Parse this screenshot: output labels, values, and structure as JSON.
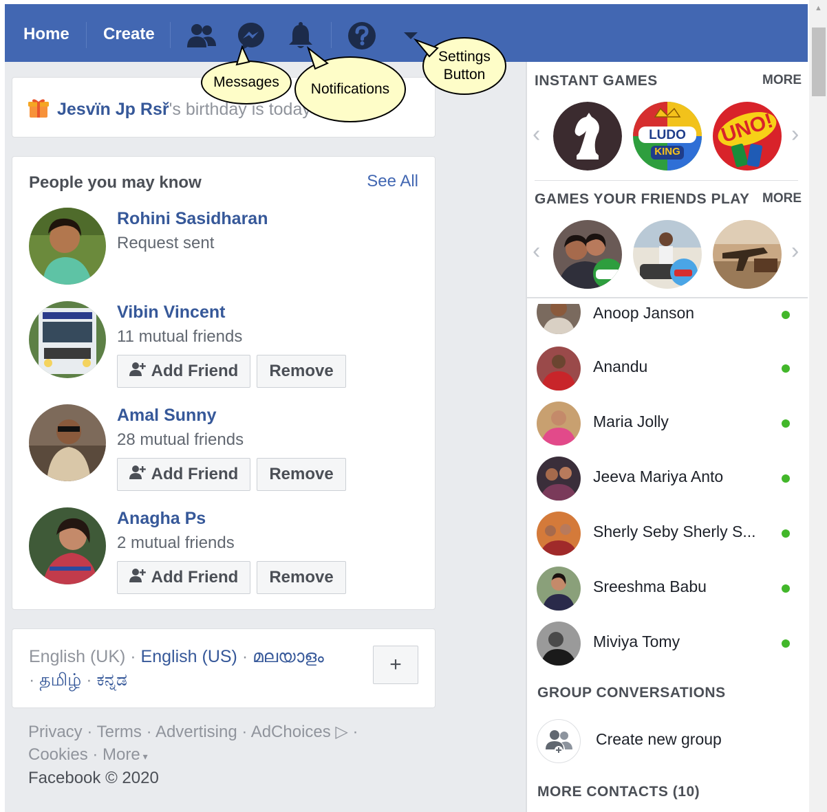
{
  "nav": {
    "home": "Home",
    "create": "Create"
  },
  "callouts": {
    "messages": "Messages",
    "notifications": "Notifications",
    "settings": "Settings\nButton"
  },
  "birthday": {
    "name": "Jesvïn Jp Rsř",
    "suffix": "'s birthday is today"
  },
  "pymk": {
    "title": "People you may know",
    "see_all": "See All",
    "add_friend": "Add Friend",
    "remove": "Remove",
    "people": [
      {
        "name": "Rohini Sasidharan",
        "sub": "Request sent"
      },
      {
        "name": "Vibin Vincent",
        "sub": "11 mutual friends"
      },
      {
        "name": "Amal Sunny",
        "sub": "28 mutual friends"
      },
      {
        "name": "Anagha Ps",
        "sub": "2 mutual friends"
      }
    ]
  },
  "languages": {
    "current": "English (UK)",
    "sep": " · ",
    "links": [
      "English (US)",
      "മലയാളം",
      "தமிழ்",
      "ಕನ್ನಡ"
    ],
    "add": "+"
  },
  "footer": {
    "privacy": "Privacy",
    "terms": "Terms",
    "advertising": "Advertising",
    "adchoices": "AdChoices",
    "cookies": "Cookies",
    "more": "More",
    "copyright": "Facebook © 2020"
  },
  "instant_games": {
    "title": "INSTANT GAMES",
    "more": "MORE",
    "ludo_text": "LUDO",
    "ludo_king": "KING",
    "uno_text": "UNO!"
  },
  "friends_games": {
    "title": "GAMES YOUR FRIENDS PLAY",
    "more": "MORE"
  },
  "contacts": [
    {
      "name": "Anoop Janson"
    },
    {
      "name": "Anandu"
    },
    {
      "name": "Maria Jolly"
    },
    {
      "name": "Jeeva Mariya Anto"
    },
    {
      "name": "Sherly Seby Sherly S..."
    },
    {
      "name": "Sreeshma Babu"
    },
    {
      "name": "Miviya Tomy"
    }
  ],
  "group_conversations": {
    "title": "GROUP CONVERSATIONS",
    "create": "Create new group"
  },
  "more_contacts": "MORE CONTACTS (10)",
  "colors": {
    "brand": "#4267b2",
    "link": "#365899",
    "online": "#42b72a",
    "callout": "#fefdc8"
  }
}
